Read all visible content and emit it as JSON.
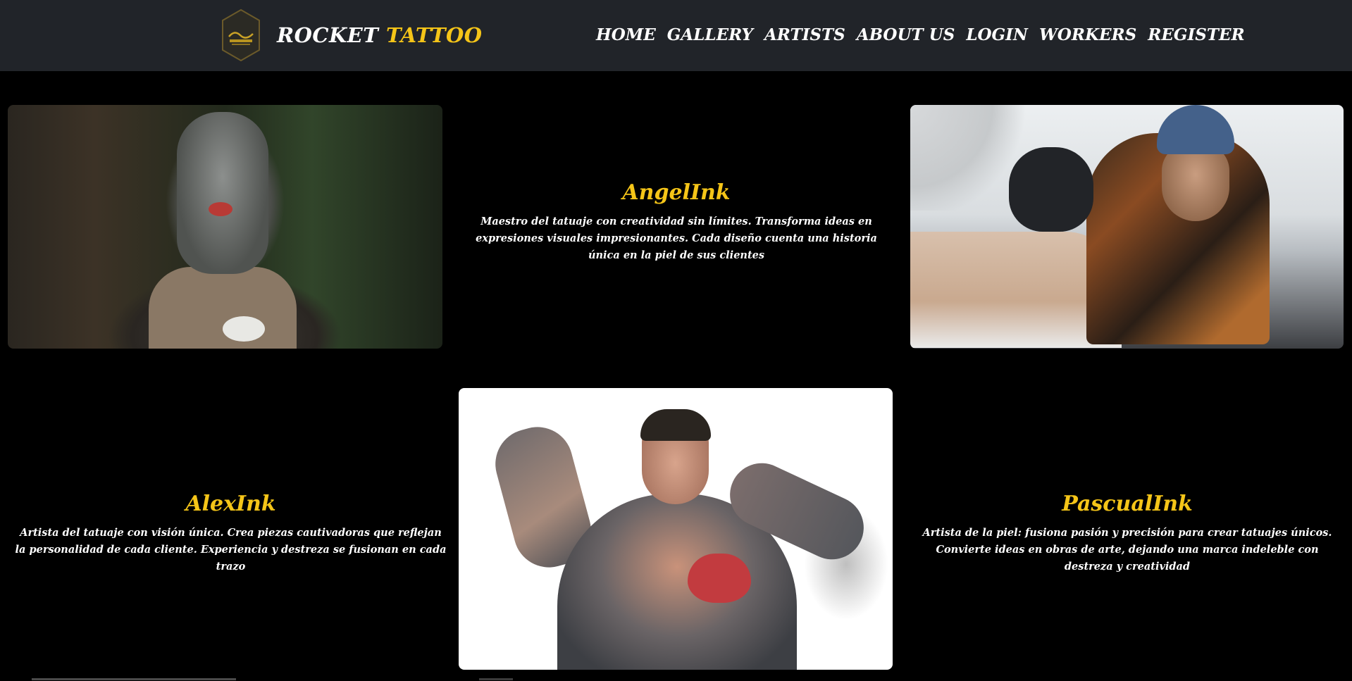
{
  "header": {
    "brand_primary": "ROCKET",
    "brand_accent": "TATTOO",
    "logo_icon": "rocket-tattoo-hexagon-logo",
    "nav": [
      "HOME",
      "GALLERY",
      "ARTISTS",
      "ABOUT US",
      "LOGIN",
      "WORKERS",
      "REGISTER"
    ]
  },
  "artists": [
    {
      "name": "AngelInk",
      "description": "Maestro del tatuaje con creatividad sin límites. Transforma ideas en expresiones visuales impresionantes. Cada diseño cuenta una historia única en la piel de sus clientes"
    },
    {
      "name": "AlexInk",
      "description": "Artista del tatuaje con visión única. Crea piezas cautivadoras que reflejan la personalidad de cada cliente. Experiencia y destreza se fusionan en cada trazo"
    },
    {
      "name": "PascualInk",
      "description": "Artista de la piel: fusiona pasión y precisión para crear tatuajes únicos. Convierte ideas en obras de arte, dejando una marca indeleble con destreza y creatividad"
    }
  ],
  "colors": {
    "background": "#000000",
    "header_bg": "#212429",
    "accent": "#f5c518",
    "text": "#ffffff"
  }
}
